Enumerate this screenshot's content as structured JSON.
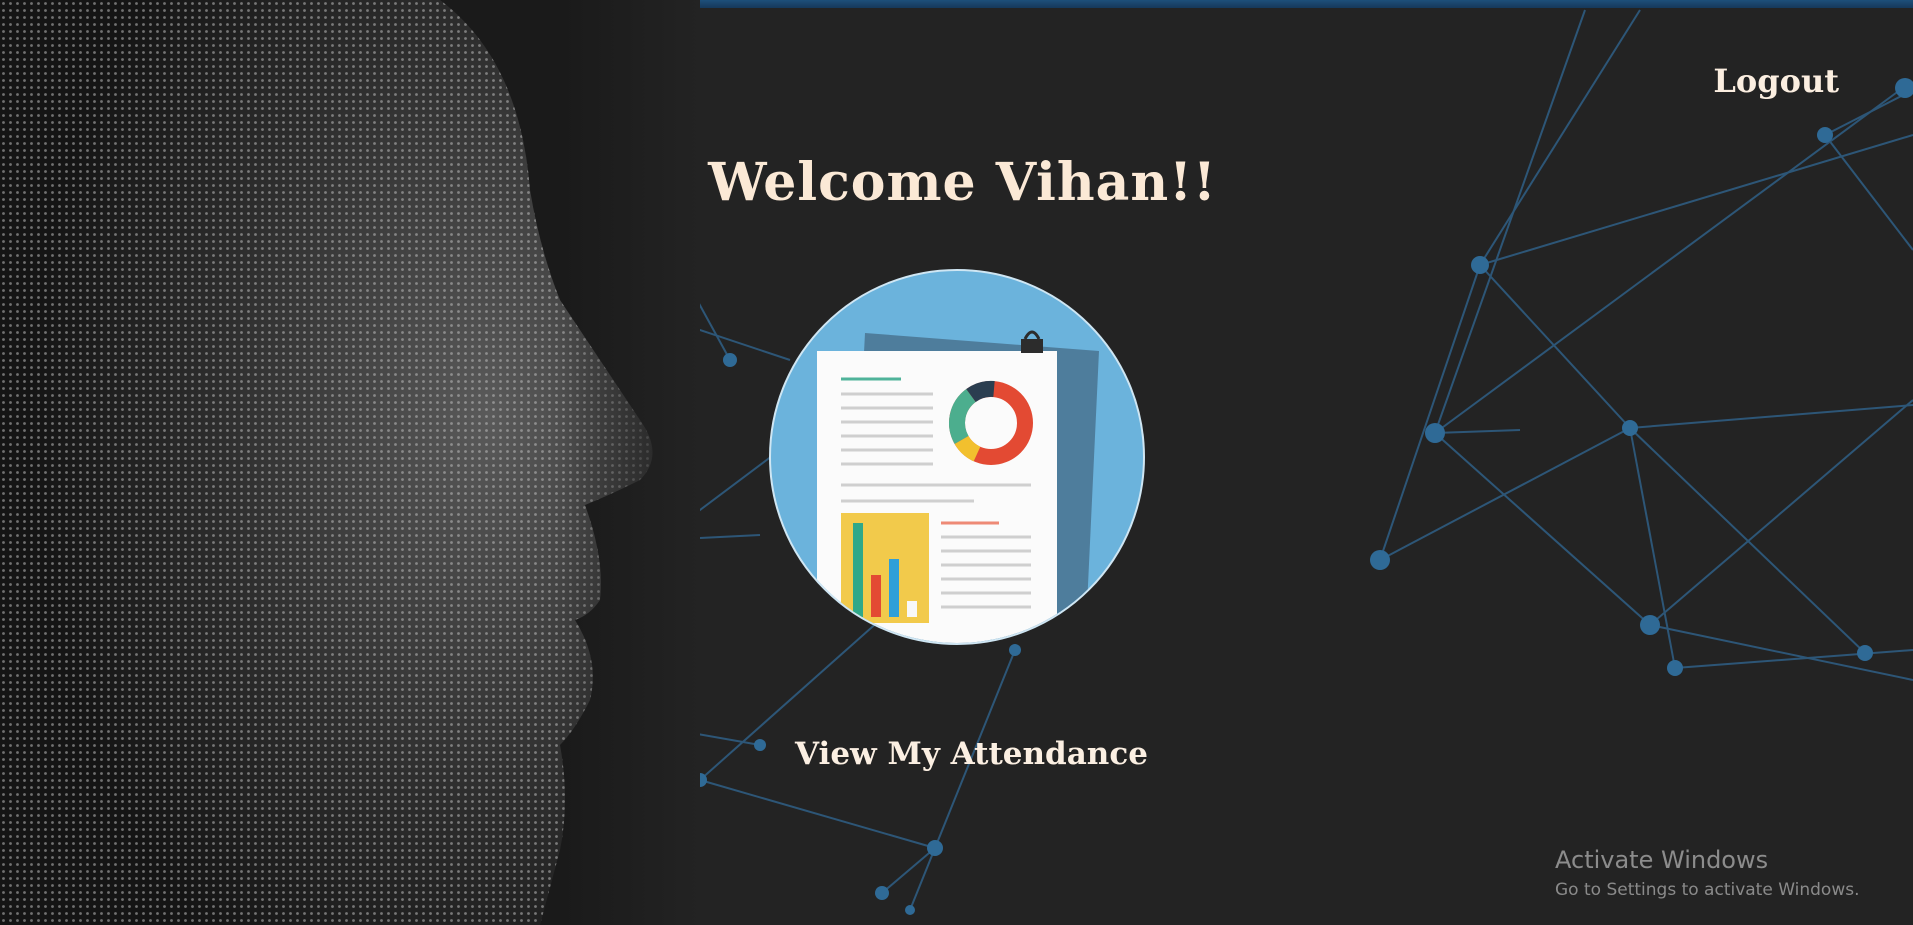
{
  "header": {
    "logout_label": "Logout"
  },
  "main": {
    "welcome_text": "Welcome Vihan!!",
    "attendance_link_label": "View My Attendance",
    "illustration_icon": "attendance-report-icon"
  },
  "os_watermark": {
    "title": "Activate Windows",
    "subtitle": "Go to Settings to activate Windows."
  },
  "colors": {
    "background": "#232323",
    "text": "#fbe9d6",
    "network_lines": "#2f5f86",
    "illustration_circle": "#6bb3dc"
  }
}
